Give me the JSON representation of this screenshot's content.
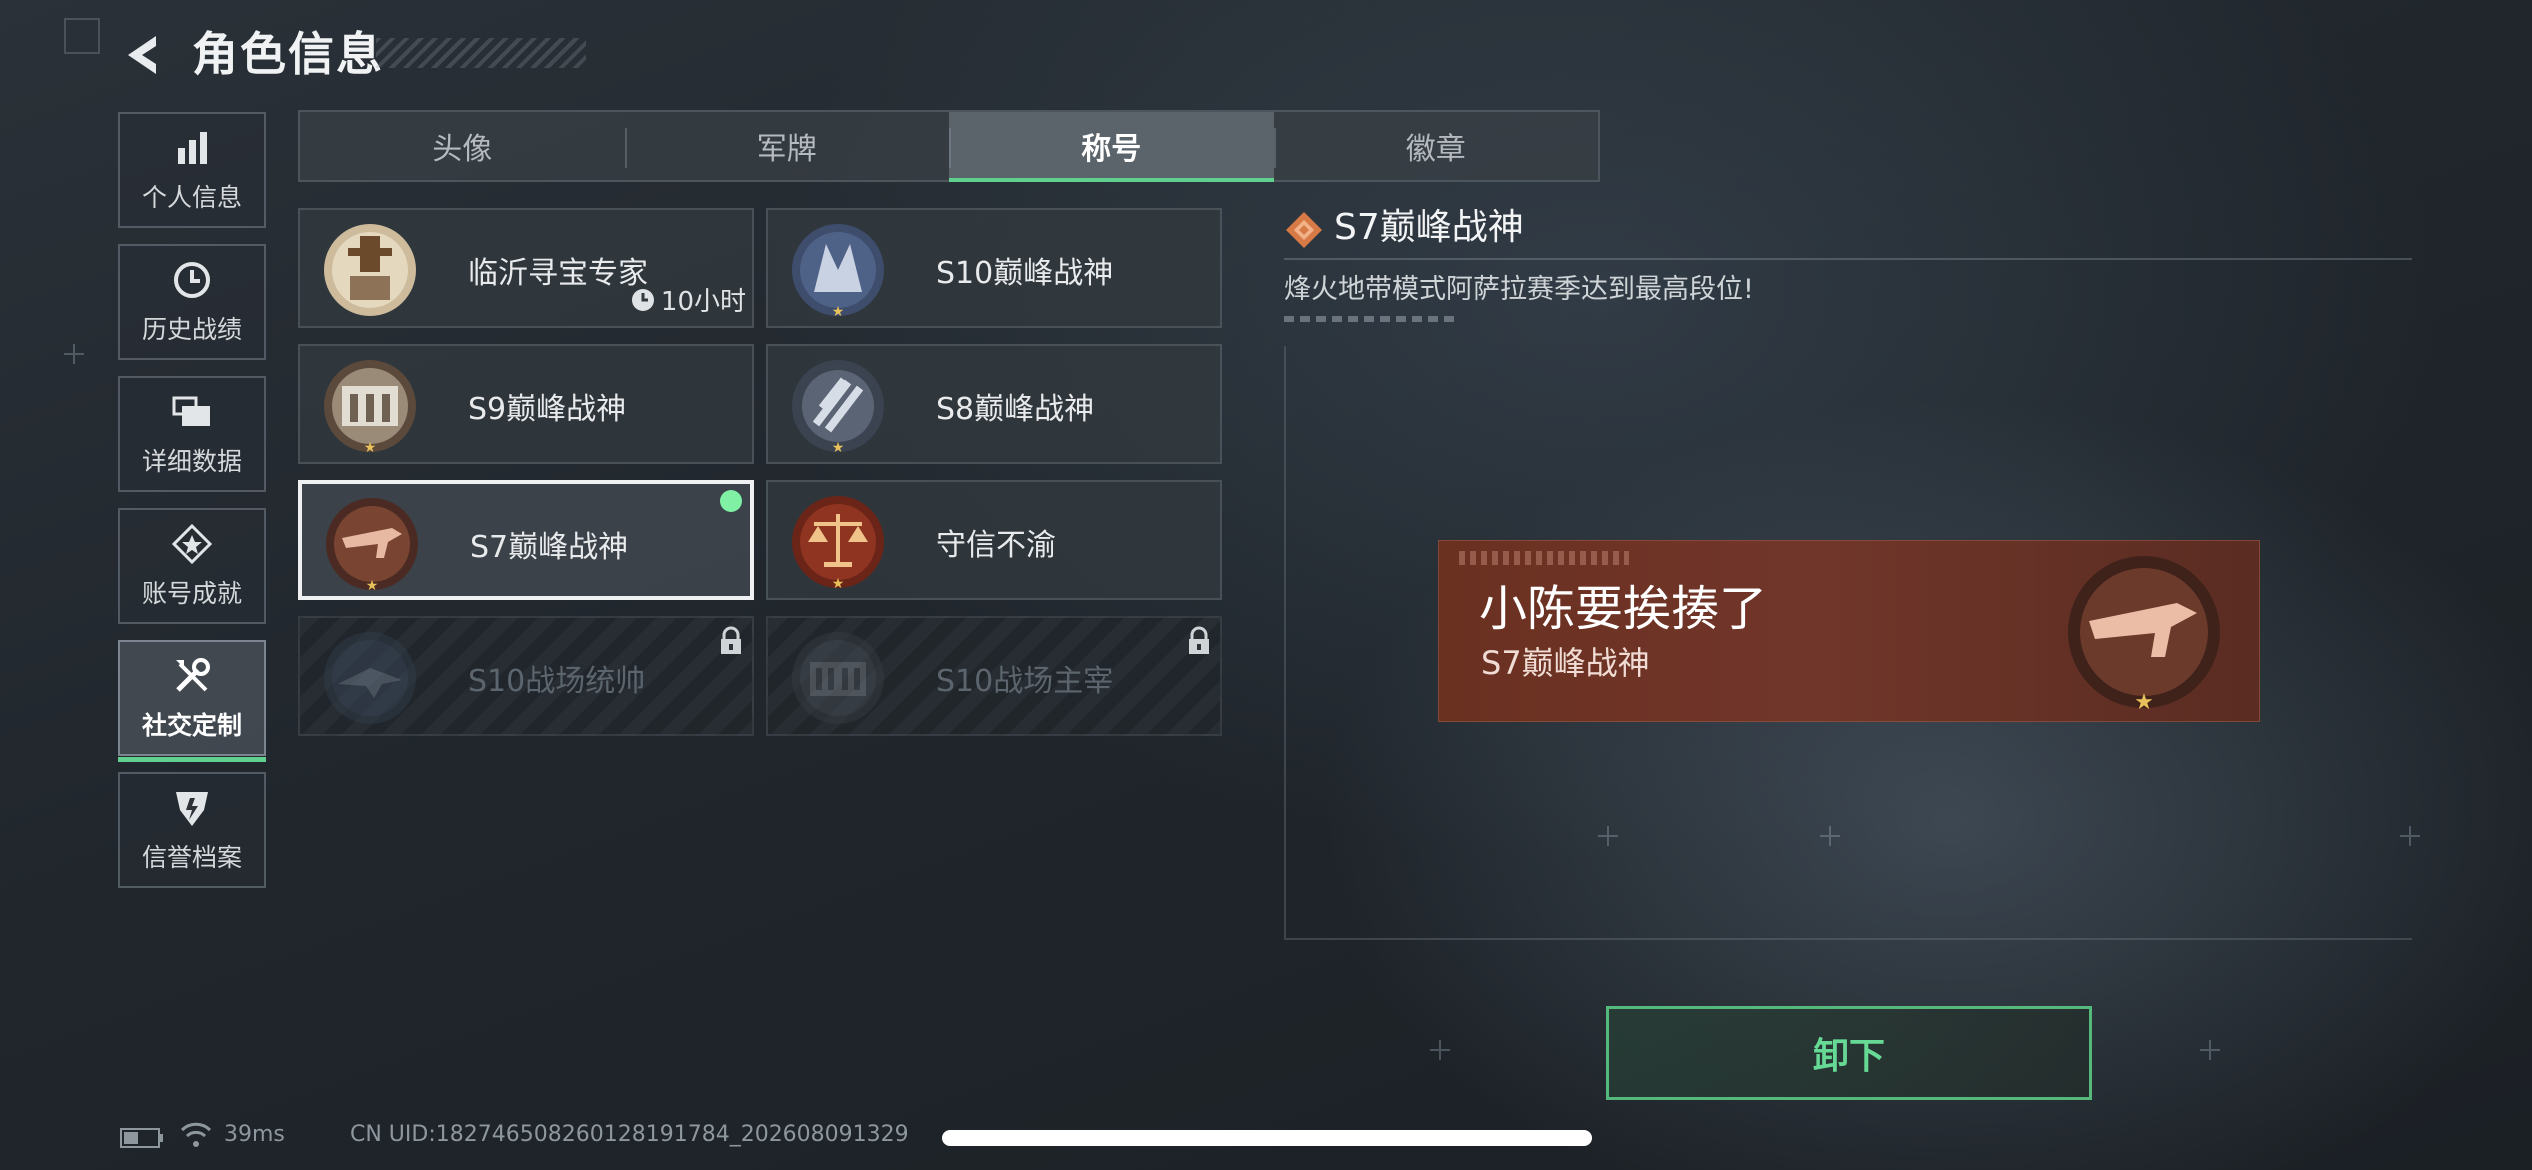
{
  "header": {
    "title": "角色信息",
    "back_icon": "back-arrow-icon"
  },
  "sidebar": {
    "items": [
      {
        "label": "个人信息",
        "icon": "bar-chart-icon"
      },
      {
        "label": "历史战绩",
        "icon": "clock-history-icon"
      },
      {
        "label": "详细数据",
        "icon": "folder-stack-icon"
      },
      {
        "label": "账号成就",
        "icon": "achievement-icon"
      },
      {
        "label": "社交定制",
        "icon": "tools-icon",
        "active": true
      },
      {
        "label": "信誉档案",
        "icon": "reputation-shield-icon"
      }
    ]
  },
  "tabs": [
    {
      "label": "头像"
    },
    {
      "label": "军牌"
    },
    {
      "label": "称号",
      "active": true
    },
    {
      "label": "徽章"
    }
  ],
  "titles": [
    {
      "name": "临沂寻宝专家",
      "timer": "10小时",
      "badge": "lu-seal-badge"
    },
    {
      "name": "S10巅峰战神",
      "badge": "s10-peak-badge"
    },
    {
      "name": "S9巅峰战神",
      "badge": "s9-peak-badge"
    },
    {
      "name": "S8巅峰战神",
      "badge": "s8-peak-badge"
    },
    {
      "name": "S7巅峰战神",
      "badge": "s7-peak-badge",
      "selected": true,
      "equipped": true
    },
    {
      "name": "守信不渝",
      "badge": "scales-badge"
    },
    {
      "name": "S10战场统帅",
      "badge": "s10-commander-badge",
      "locked": true
    },
    {
      "name": "S10战场主宰",
      "badge": "s10-dominator-badge",
      "locked": true
    }
  ],
  "detail": {
    "title": "S7巅峰战神",
    "description": "烽火地带模式阿萨拉赛季达到最高段位!",
    "preview": {
      "player_name": "小陈要挨揍了",
      "title_name": "S7巅峰战神"
    }
  },
  "actions": {
    "unequip_label": "卸下"
  },
  "status": {
    "ping": "39ms",
    "uid": "CN UID:182746508260128191784_202608091329"
  },
  "colors": {
    "accent_green": "#5fd08d",
    "plate_red": "#6a3020",
    "equipped_dot": "#7ff0a4"
  }
}
